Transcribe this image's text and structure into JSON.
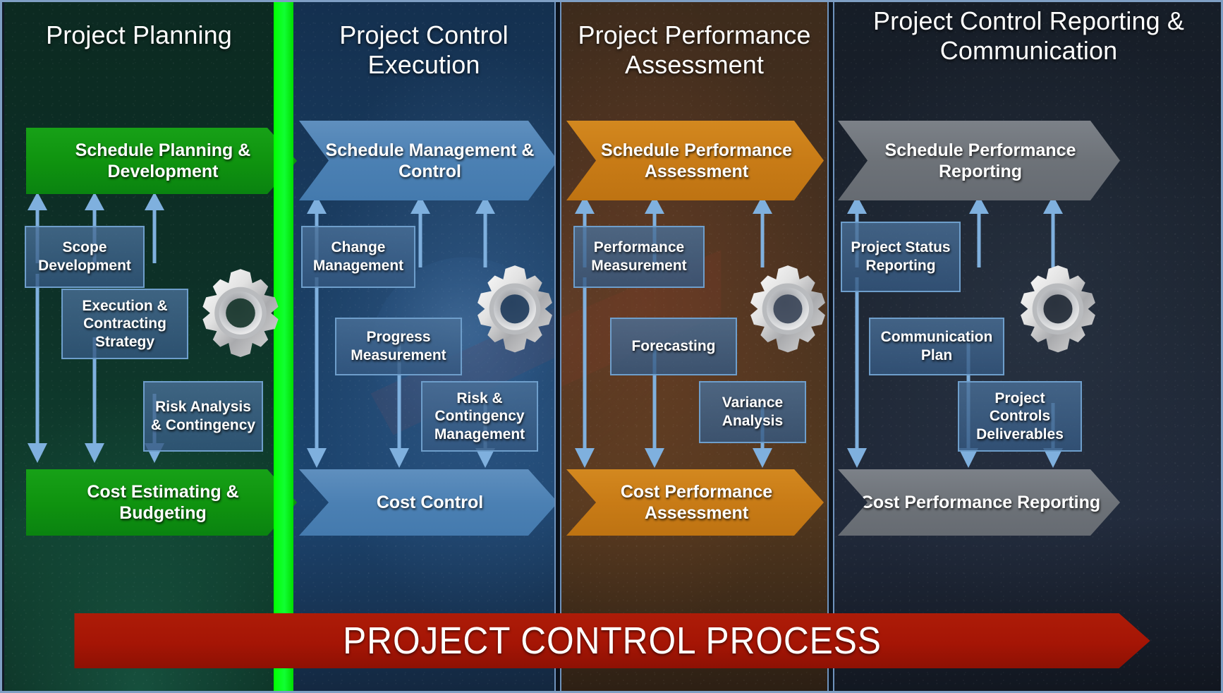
{
  "diagram": {
    "banner_label": "PROJECT CONTROL PROCESS",
    "banner_color": "#a51505",
    "accent_green": "#00ff00",
    "columns": [
      {
        "id": "project-planning",
        "title": "Project Planning",
        "accent": "#0f930f",
        "background": "#0d3027",
        "top_bar": "Schedule Planning & Development",
        "bottom_bar": "Cost Estimating & Budgeting",
        "boxes": [
          "Scope Development",
          "Execution & Contracting Strategy",
          "Risk Analysis & Contingency"
        ]
      },
      {
        "id": "project-control-execution",
        "title": "Project Control Execution",
        "accent": "#4b80b3",
        "background": "#1b3f65",
        "top_bar": "Schedule Management & Control",
        "bottom_bar": "Cost Control",
        "boxes": [
          "Change Management",
          "Progress Measurement",
          "Risk & Contingency Management"
        ]
      },
      {
        "id": "project-performance-assessment",
        "title": "Project Performance Assessment",
        "accent": "#c87b16",
        "background": "#4a3220",
        "top_bar": "Schedule Performance Assessment",
        "bottom_bar": "Cost Performance Assessment",
        "boxes": [
          "Performance Measurement",
          "Forecasting",
          "Variance Analysis"
        ]
      },
      {
        "id": "project-control-reporting-communication",
        "title": "Project Control Reporting & Communication",
        "accent": "#6d7278",
        "background": "#1b232f",
        "top_bar": "Schedule Performance Reporting",
        "bottom_bar": "Cost Performance Reporting",
        "boxes": [
          "Project Status Reporting",
          "Communication Plan",
          "Project Controls Deliverables"
        ]
      }
    ],
    "gear_icon": "gear-icon"
  }
}
